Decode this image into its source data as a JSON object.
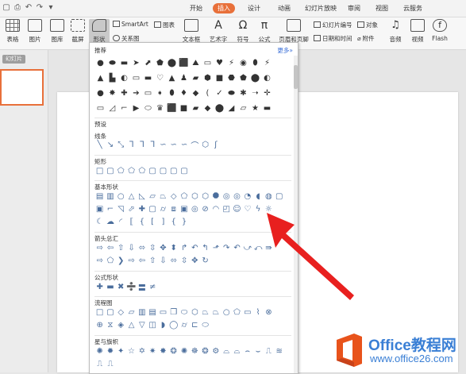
{
  "menubar": {
    "tabs": [
      {
        "label": "开始",
        "active": false
      },
      {
        "label": "插入",
        "active": true
      },
      {
        "label": "设计",
        "active": false
      },
      {
        "label": "动画",
        "active": false
      },
      {
        "label": "幻灯片放映",
        "active": false
      },
      {
        "label": "审阅",
        "active": false
      },
      {
        "label": "视图",
        "active": false
      },
      {
        "label": "云服务",
        "active": false
      }
    ],
    "accent": "#e8703a"
  },
  "ribbon": {
    "table": "表格",
    "picture": "图片",
    "gallery": "图库",
    "screenshot": "截屏",
    "shape": "形状",
    "smartart": "SmartArt",
    "chart": "图表",
    "relation": "关系图",
    "textbox": "文本框",
    "wordart": "艺术字",
    "symbol": "符号",
    "formula": "公式",
    "header_footer": "页眉和页脚",
    "slide_number": "幻灯片编号",
    "object": "对象",
    "date_time": "日期和时间",
    "attachment": "附件",
    "audio": "音频",
    "video": "视频",
    "flash": "Flash"
  },
  "left_panel": {
    "tab_label": "幻灯片"
  },
  "dropdown": {
    "recommended": "推荐",
    "more": "更多»",
    "preset": "预设",
    "sections": {
      "lines": "线条",
      "rectangles": "矩形",
      "basic": "基本形状",
      "arrows": "箭头总汇",
      "formula": "公式形状",
      "flowchart": "流程图",
      "stars": "星与旗帜"
    }
  },
  "watermark": {
    "line1": "Office教程网",
    "line2": "www.office26.com"
  }
}
